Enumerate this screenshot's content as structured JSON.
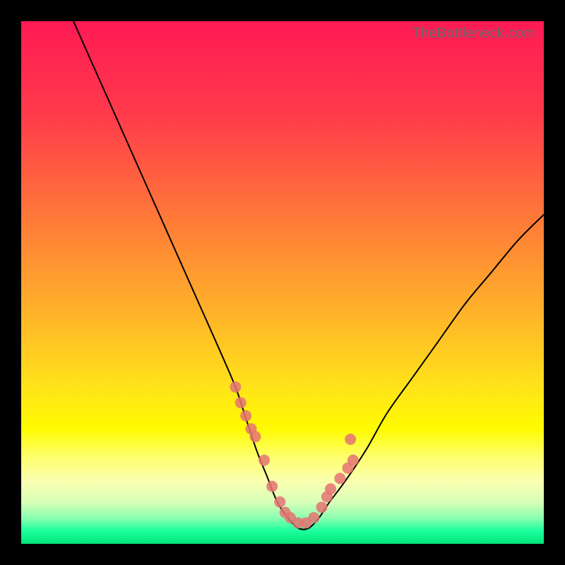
{
  "watermark": "TheBottleneck.com",
  "colors": {
    "frame": "#000000",
    "gradient_stops": [
      {
        "offset": 0.0,
        "color": "#ff1a54"
      },
      {
        "offset": 0.18,
        "color": "#ff3b4b"
      },
      {
        "offset": 0.38,
        "color": "#ff7a38"
      },
      {
        "offset": 0.55,
        "color": "#ffb02a"
      },
      {
        "offset": 0.7,
        "color": "#ffe31a"
      },
      {
        "offset": 0.78,
        "color": "#fffb00"
      },
      {
        "offset": 0.83,
        "color": "#fdff66"
      },
      {
        "offset": 0.88,
        "color": "#fbffb0"
      },
      {
        "offset": 0.92,
        "color": "#d8ffb8"
      },
      {
        "offset": 0.95,
        "color": "#8cffb0"
      },
      {
        "offset": 0.975,
        "color": "#1eff9e"
      },
      {
        "offset": 1.0,
        "color": "#00e57a"
      }
    ],
    "curve": "#000000",
    "dot": "#e57373"
  },
  "chart_data": {
    "type": "line",
    "title": "",
    "xlabel": "",
    "ylabel": "",
    "xlim": [
      0,
      100
    ],
    "ylim": [
      0,
      100
    ],
    "grid": false,
    "legend": false,
    "series": [
      {
        "name": "curve",
        "x": [
          10,
          14,
          18,
          22,
          26,
          30,
          34,
          38,
          41,
          43,
          45,
          47,
          49,
          51,
          53,
          55,
          57,
          59,
          62,
          66,
          70,
          75,
          80,
          85,
          90,
          95,
          100
        ],
        "y": [
          100,
          91,
          82,
          73,
          64,
          55,
          46,
          37,
          30,
          24,
          18,
          13,
          8,
          5,
          3,
          3,
          5,
          8,
          12,
          18,
          25,
          32,
          39,
          46,
          52,
          58,
          63
        ]
      }
    ],
    "scatter_points": {
      "name": "dots",
      "x": [
        41.0,
        42.0,
        43.0,
        44.0,
        44.8,
        46.5,
        48.0,
        49.5,
        50.5,
        51.5,
        53.0,
        54.5,
        56.0,
        57.5,
        58.5,
        59.2,
        61.0,
        62.5,
        63.5,
        63.0
      ],
      "y": [
        30.0,
        27.0,
        24.5,
        22.0,
        20.5,
        16.0,
        11.0,
        8.0,
        6.0,
        5.0,
        4.0,
        4.0,
        5.0,
        7.0,
        9.0,
        10.5,
        12.5,
        14.5,
        16.0,
        20.0
      ]
    }
  }
}
